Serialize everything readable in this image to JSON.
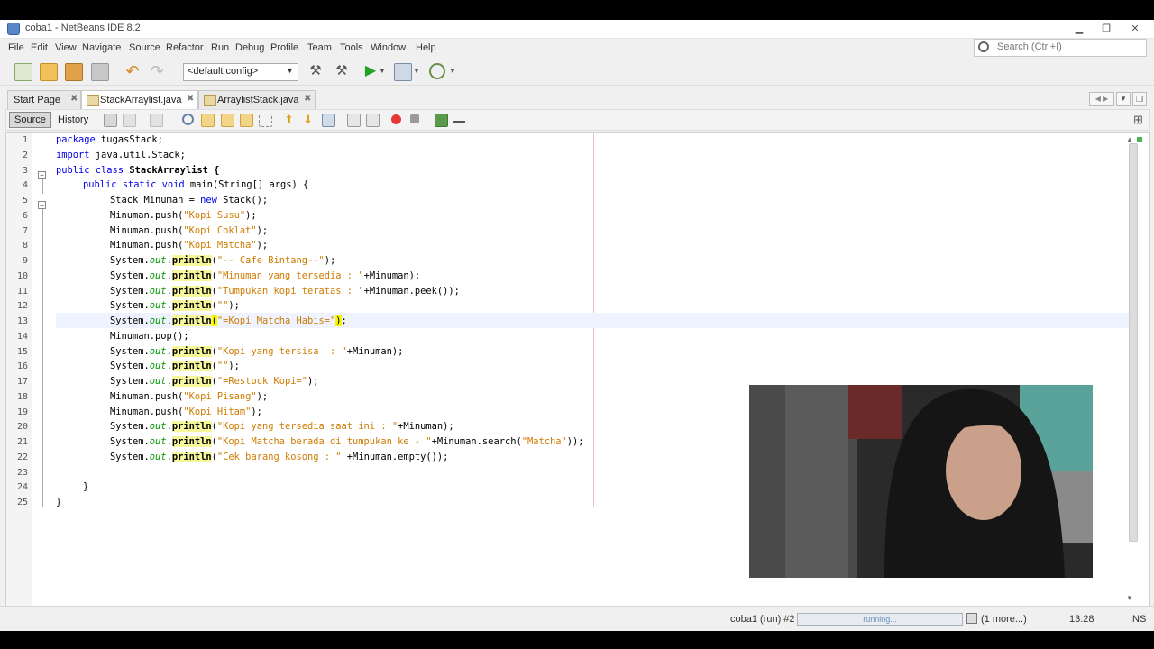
{
  "window": {
    "title": "coba1 - NetBeans IDE 8.2"
  },
  "menu": [
    "File",
    "Edit",
    "View",
    "Navigate",
    "Source",
    "Refactor",
    "Run",
    "Debug",
    "Profile",
    "Team",
    "Tools",
    "Window",
    "Help"
  ],
  "search": {
    "placeholder": "Search (Ctrl+I)"
  },
  "toolbar": {
    "config": "<default config>"
  },
  "tabs": [
    {
      "label": "Start Page",
      "active": false
    },
    {
      "label": "StackArraylist.java",
      "active": true
    },
    {
      "label": "ArraylistStack.java",
      "active": false
    }
  ],
  "editor_toolbar": {
    "source_label": "Source",
    "history_label": "History"
  },
  "line_numbers": [
    "1",
    "2",
    "3",
    "4",
    "5",
    "6",
    "7",
    "8",
    "9",
    "10",
    "11",
    "12",
    "13",
    "14",
    "15",
    "16",
    "17",
    "18",
    "19",
    "20",
    "21",
    "22",
    "23",
    "24",
    "25"
  ],
  "code": {
    "package_kw": "package",
    "package_name": " tugasStack;",
    "import_kw": "import",
    "import_name": " java.util.Stack;",
    "class_kw": "public class",
    "class_name": " StackArraylist {",
    "main_kw": "public static void",
    "main_rest": " main(String[] args) {",
    "l5_a": "Stack Minuman = ",
    "l5_kw": "new",
    "l5_b": " Stack();",
    "push": "Minuman.push(",
    "sys": "System.",
    "out": "out",
    "dot": ".",
    "println": "println",
    "s_susu": "\"Kopi Susu\"",
    "s_coklat": "\"Kopi Coklat\"",
    "s_matcha": "\"Kopi Matcha\"",
    "s_cafe": "\"-- Cafe Bintang--\"",
    "s_tersedia": "\"Minuman yang tersedia : \"",
    "plus_minuman": "+Minuman);",
    "s_teratas": "\"Tumpukan kopi teratas : \"",
    "plus_peek": "+Minuman.peek());",
    "s_empty": "\"\"",
    "close": ");",
    "s_habis": "\"=Kopi Matcha Habis=\"",
    "pop": "Minuman.pop();",
    "s_tersisa": "\"Kopi yang tersisa  : \"",
    "s_restock": "\"=Restock Kopi=\"",
    "s_pisang": "\"Kopi Pisang\"",
    "s_hitam": "\"Kopi Hitam\"",
    "s_saatini": "\"Kopi yang tersedia saat ini : \"",
    "s_berada": "\"Kopi Matcha berada di tumpukan ke - \"",
    "plus_search": "+Minuman.search(",
    "s_matcha2": "\"Matcha\"",
    "close2": "));",
    "s_cek": "\"Cek barang kosong : \"",
    "plus_empty": " +Minuman.empty());",
    "brace": "}",
    "open_paren": "(",
    "close_paren": ")"
  },
  "status": {
    "run_label": "coba1 (run) #2",
    "progress_text": "running...",
    "more": "(1 more...)",
    "position": "13:28",
    "mode": "INS"
  },
  "colors": {
    "keyword": "#0000e6",
    "string": "#ce7b00",
    "field": "#009900",
    "method_highlight": "#f7f79b"
  }
}
